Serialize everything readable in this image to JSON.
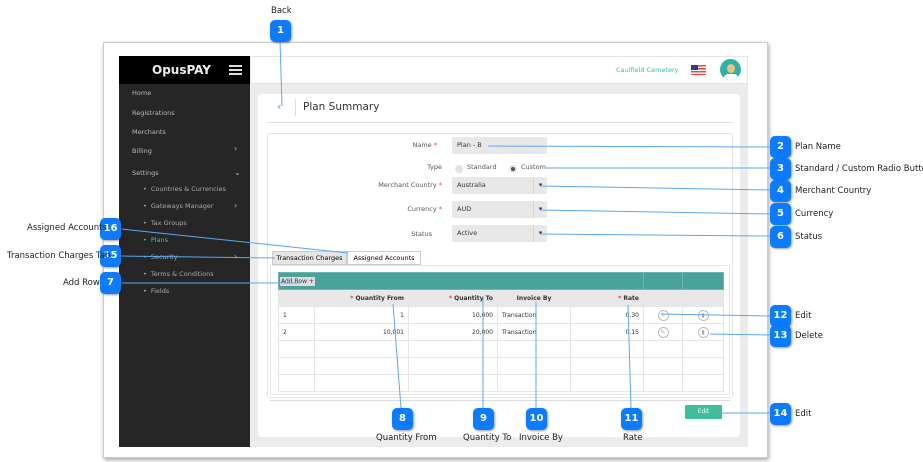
{
  "app": {
    "brand": "OpusPAY",
    "merchant": "Caulfield Cemetery"
  },
  "sidebar": {
    "items": [
      {
        "label": "Home"
      },
      {
        "label": "Registrations"
      },
      {
        "label": "Merchants"
      },
      {
        "label": "Billing"
      },
      {
        "label": "Settings"
      }
    ],
    "settings_items": [
      {
        "label": "Countries & Currencies"
      },
      {
        "label": "Gateways Manager"
      },
      {
        "label": "Tax Groups"
      },
      {
        "label": "Plans",
        "active": true
      },
      {
        "label": "Security"
      },
      {
        "label": "Terms & Conditions"
      },
      {
        "label": "Fields"
      }
    ]
  },
  "page": {
    "title": "Plan Summary"
  },
  "form": {
    "name_label": "Name",
    "name_value": "Plan - B",
    "type_label": "Type",
    "type_options": [
      "Standard",
      "Custom"
    ],
    "type_selected": "Custom",
    "country_label": "Merchant Country",
    "country_value": "Australia",
    "currency_label": "Currency",
    "currency_value": "AUD",
    "status_label": "Status",
    "status_value": "Active"
  },
  "tabs": [
    {
      "label": "Transaction Charges",
      "active": true
    },
    {
      "label": "Assigned Accounts"
    }
  ],
  "table": {
    "add_row": "Add Row +",
    "headers": [
      "Quantity From",
      "Quantity To",
      "Invoice By",
      "Rate"
    ],
    "rows": [
      [
        "1",
        "1",
        "10,000",
        "Transaction",
        "0.30"
      ],
      [
        "2",
        "10,001",
        "20,000",
        "Transaction",
        "0.15"
      ]
    ]
  },
  "edit_button": "Edit",
  "callouts": [
    {
      "n": "1",
      "label": "Back"
    },
    {
      "n": "2",
      "label": "Plan Name"
    },
    {
      "n": "3",
      "label": "Standard / Custom Radio Buttons"
    },
    {
      "n": "4",
      "label": "Merchant Country"
    },
    {
      "n": "5",
      "label": "Currency"
    },
    {
      "n": "6",
      "label": "Status"
    },
    {
      "n": "7",
      "label": "Add Row"
    },
    {
      "n": "8",
      "label": "Quantity From"
    },
    {
      "n": "9",
      "label": "Quantity To"
    },
    {
      "n": "10",
      "label": "Invoice By"
    },
    {
      "n": "11",
      "label": "Rate"
    },
    {
      "n": "12",
      "label": "Edit"
    },
    {
      "n": "13",
      "label": "Delete"
    },
    {
      "n": "14",
      "label": "Edit"
    },
    {
      "n": "15",
      "label": "Transaction Charges Tab"
    },
    {
      "n": "16",
      "label": "Assigned Accounts"
    }
  ],
  "colors": {
    "accent": "#4aa39b",
    "callout": "#0b7bff",
    "active_nav": "#3cc2b0",
    "edit_button": "#3dbf9c"
  }
}
